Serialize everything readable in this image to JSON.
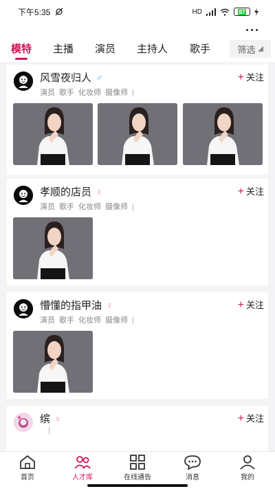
{
  "status_bar": {
    "time": "下午5:35",
    "network": "HD",
    "battery": "87"
  },
  "header": {
    "more": "···"
  },
  "tabs": [
    {
      "label": "模特",
      "active": true
    },
    {
      "label": "主播",
      "active": false
    },
    {
      "label": "演员",
      "active": false
    },
    {
      "label": "主持人",
      "active": false
    },
    {
      "label": "歌手",
      "active": false
    }
  ],
  "filter": {
    "label": "筛选"
  },
  "cards": [
    {
      "name": "风雪夜归人",
      "gender": "♂",
      "follow": "关注",
      "tags": [
        "演员",
        "歌手",
        "化妆师",
        "摄像师"
      ],
      "photos": 3
    },
    {
      "name": "孝顺的店员",
      "gender": "♀",
      "follow": "关注",
      "tags": [
        "演员",
        "歌手",
        "化妆师",
        "摄像师"
      ],
      "photos": 1
    },
    {
      "name": "懵懂的指甲油",
      "gender": "♀",
      "follow": "关注",
      "tags": [
        "演员",
        "歌手",
        "化妆师",
        "摄像师"
      ],
      "photos": 1
    },
    {
      "name": "缤",
      "gender": "♀",
      "follow": "关注",
      "tags": [],
      "photos": 0
    }
  ],
  "bottom_nav": [
    {
      "label": "首页",
      "icon": "home-icon",
      "active": false
    },
    {
      "label": "人才库",
      "icon": "people-icon",
      "active": true
    },
    {
      "label": "在线通告",
      "icon": "grid-icon",
      "active": false
    },
    {
      "label": "消息",
      "icon": "chat-icon",
      "active": false
    },
    {
      "label": "我的",
      "icon": "user-icon",
      "active": false
    }
  ],
  "colors": {
    "accent": "#d4145a",
    "male": "#4aa8e8",
    "female": "#f08ab0"
  }
}
